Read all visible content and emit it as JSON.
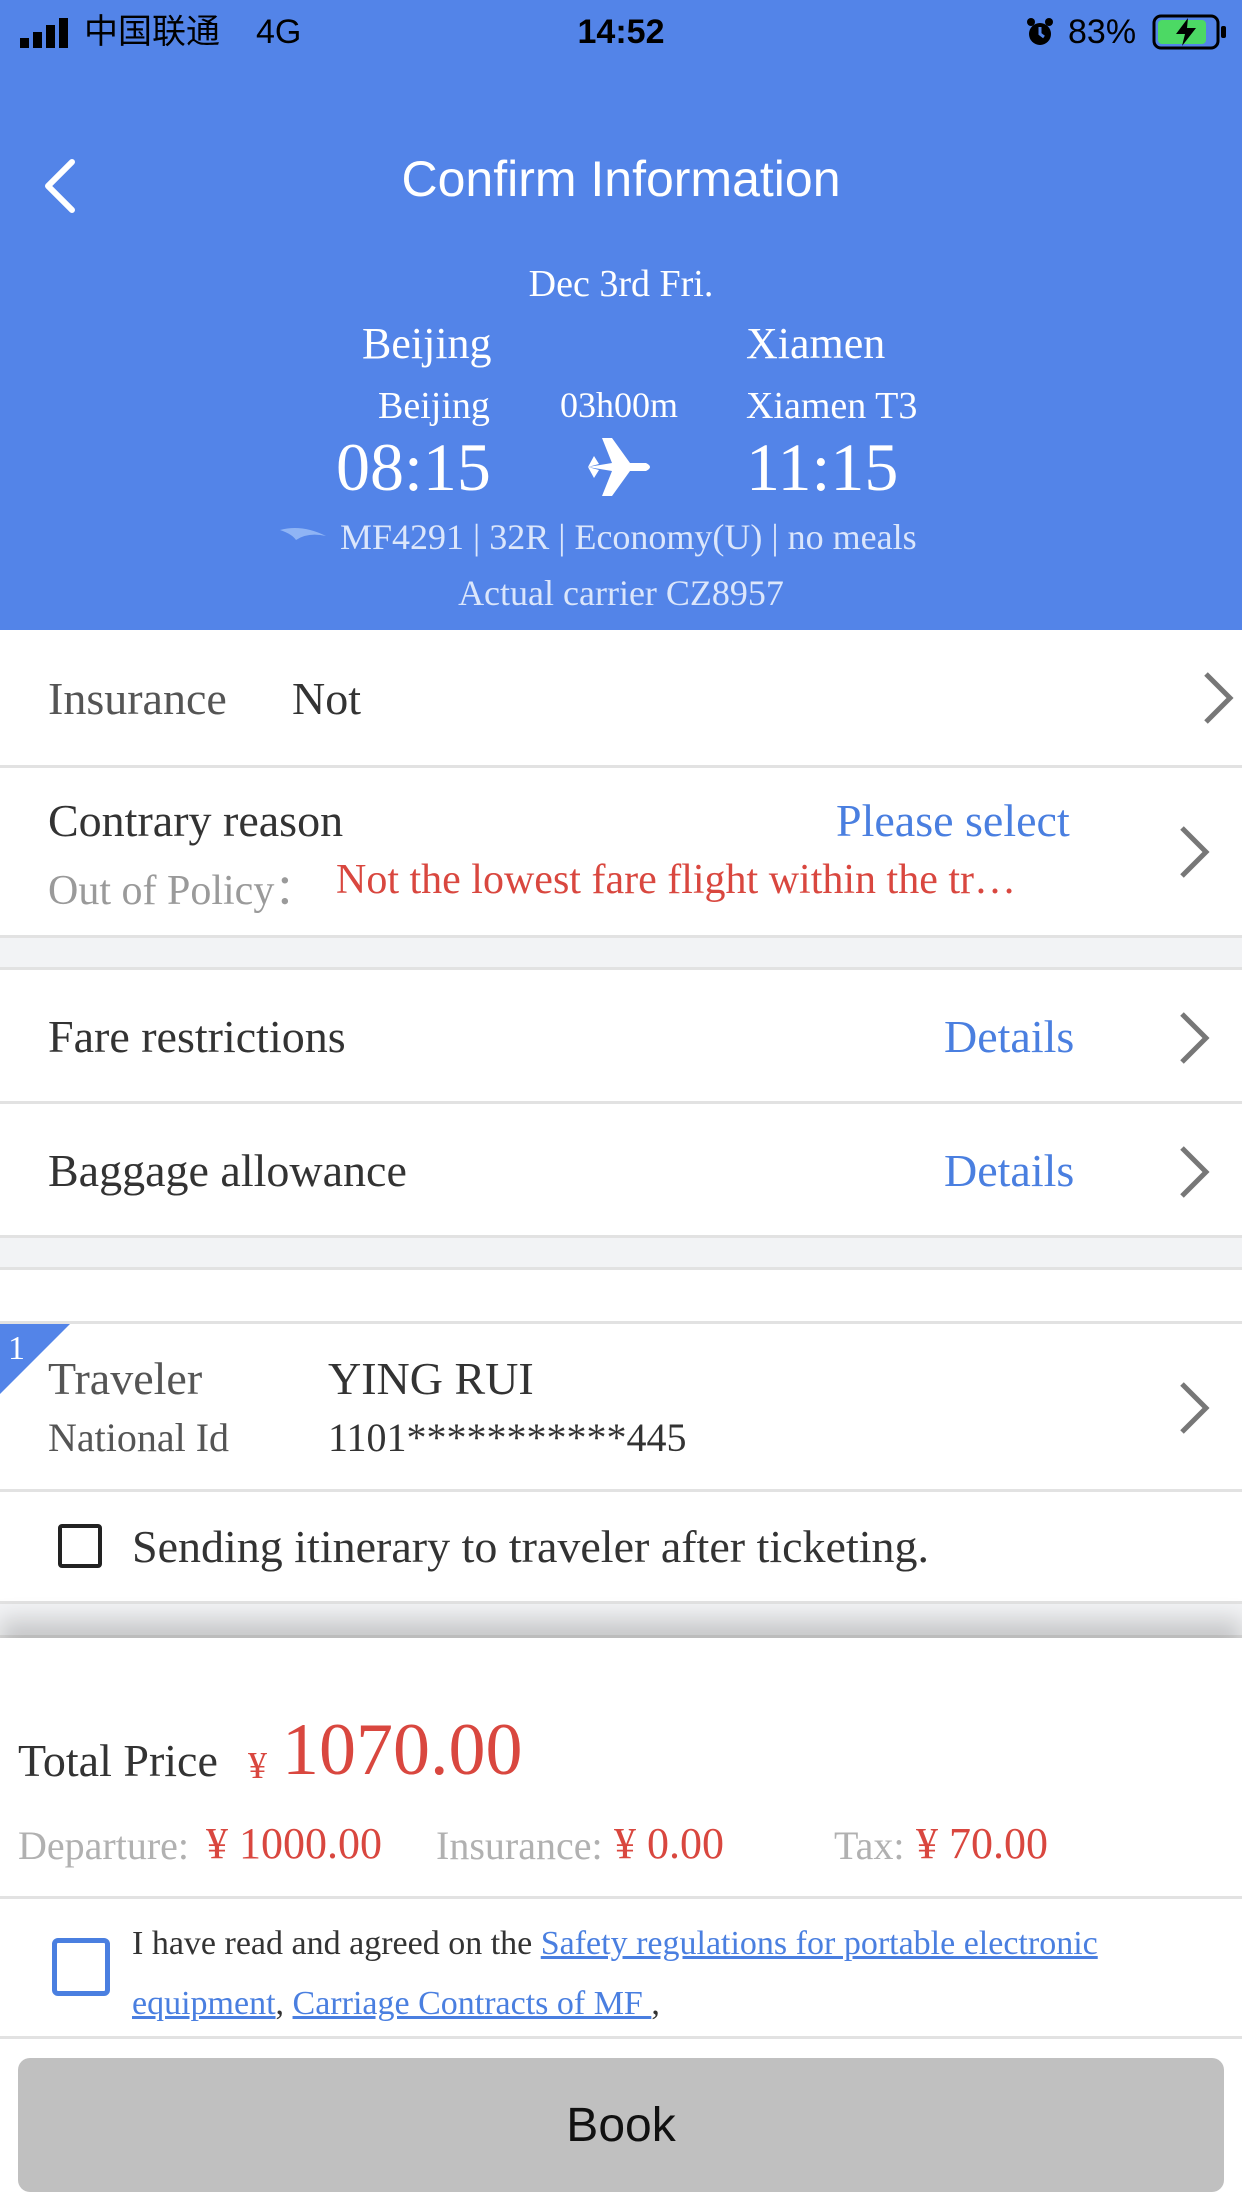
{
  "status_bar": {
    "carrier": "中国联通",
    "network": "4G",
    "time": "14:52",
    "battery": "83%"
  },
  "header": {
    "title": "Confirm Information",
    "date": "Dec 3rd Fri.",
    "from_city": "Beijing",
    "from_airport": "Beijing",
    "to_city": "Xiamen",
    "to_airport": "Xiamen T3",
    "duration": "03h00m",
    "depart_time": "08:15",
    "arrive_time": "11:15",
    "flight_info": "MF4291 | 32R | Economy(U) | no meals",
    "carrier_info": "Actual carrier CZ8957"
  },
  "insurance": {
    "label": "Insurance",
    "value": "Not"
  },
  "contrary": {
    "label": "Contrary reason",
    "action": "Please select",
    "policy_label": "Out of Policy：",
    "policy_value": "Not the lowest fare flight within the tr…"
  },
  "fare": {
    "label": "Fare restrictions",
    "action": "Details"
  },
  "baggage": {
    "label": "Baggage allowance",
    "action": "Details"
  },
  "traveler": {
    "index": "1",
    "label": "Traveler",
    "name": "YING RUI",
    "id_label": "National Id",
    "id_value": "1101***********445"
  },
  "itinerary_checkbox": {
    "label": "Sending itinerary to traveler after ticketing."
  },
  "price": {
    "total_label": "Total Price",
    "currency": "¥",
    "total": "1070.00",
    "departure_label": "Departure:",
    "departure_value": "¥ 1000.00",
    "insurance_label": "Insurance:",
    "insurance_value": "¥ 0.00",
    "tax_label": "Tax:",
    "tax_value": "¥ 70.00"
  },
  "agreement": {
    "prefix": "I have read and agreed on the ",
    "link1": "Safety regulations for portable electronic equipment",
    "sep": ", ",
    "link2": "Carriage Contracts of MF ",
    "suffix": ","
  },
  "book_button": {
    "label": "Book"
  },
  "colors": {
    "header_blue": "#5384e8",
    "link_blue": "#4a7fe0",
    "price_red": "#d9473f"
  }
}
